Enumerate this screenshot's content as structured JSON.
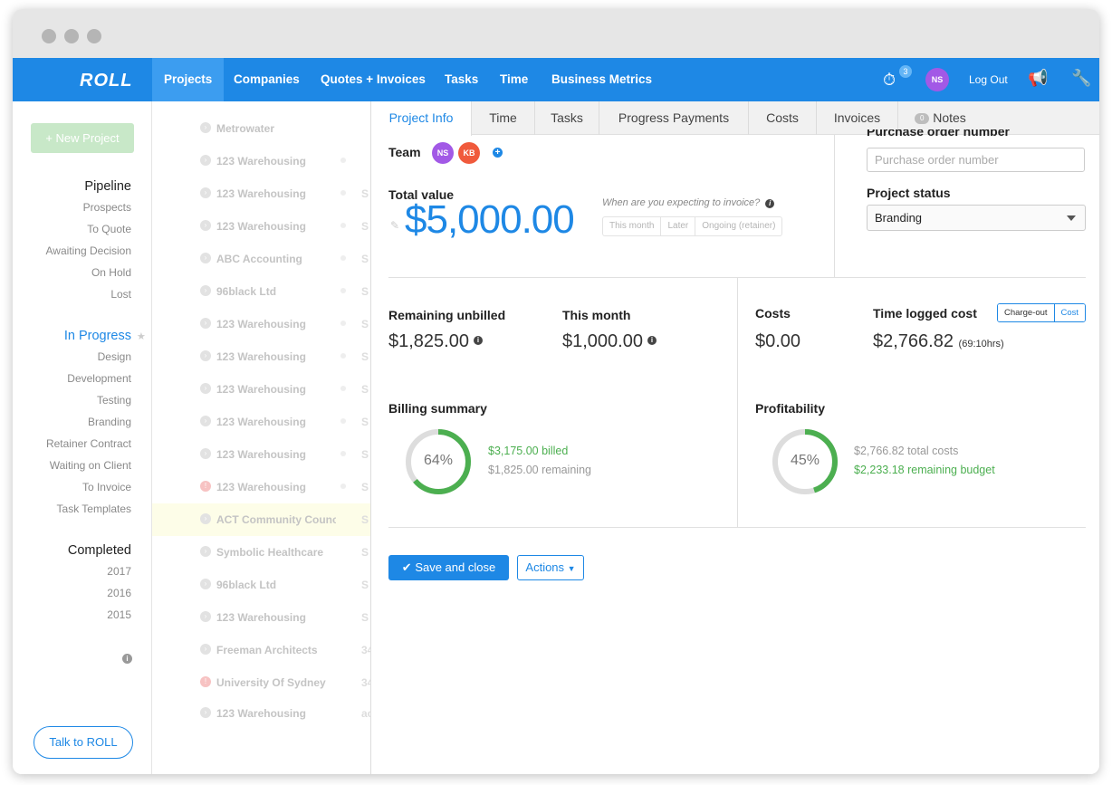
{
  "app": {
    "logo": "ROLL"
  },
  "nav": {
    "items": [
      "Projects",
      "Companies",
      "Quotes + Invoices",
      "Tasks",
      "Time",
      "Business Metrics"
    ],
    "timer_badge": "3",
    "user_initials": "NS",
    "logout_label": "Log Out"
  },
  "sidebar": {
    "new_project": "+ New Project",
    "pipeline": {
      "title": "Pipeline",
      "items": [
        "Prospects",
        "To Quote",
        "Awaiting Decision",
        "On Hold",
        "Lost"
      ]
    },
    "in_progress": {
      "title": "In Progress",
      "items": [
        "Design",
        "Development",
        "Testing",
        "Branding",
        "Retainer Contract",
        "Waiting on Client",
        "To Invoice",
        "Task Templates"
      ]
    },
    "completed": {
      "title": "Completed",
      "items": [
        "2017",
        "2016",
        "2015"
      ]
    },
    "talk_label": "Talk to ROLL"
  },
  "projects": [
    {
      "name": "Metrowater",
      "trail": ""
    },
    {
      "name": "123 Warehousing",
      "trail": ""
    },
    {
      "name": "123 Warehousing",
      "trail": "S"
    },
    {
      "name": "123 Warehousing",
      "trail": "S"
    },
    {
      "name": "ABC Accounting",
      "trail": "S"
    },
    {
      "name": "96black Ltd",
      "trail": "S"
    },
    {
      "name": "123 Warehousing",
      "trail": "S"
    },
    {
      "name": "123 Warehousing",
      "trail": "S"
    },
    {
      "name": "123 Warehousing",
      "trail": "S"
    },
    {
      "name": "123 Warehousing",
      "trail": "S"
    },
    {
      "name": "123 Warehousing",
      "trail": "S"
    },
    {
      "name": "123 Warehousing",
      "trail": "S"
    },
    {
      "name": "ACT Community Counc",
      "trail": "S"
    },
    {
      "name": "Symbolic Healthcare",
      "trail": "S"
    },
    {
      "name": "96black Ltd",
      "trail": "S"
    },
    {
      "name": "123 Warehousing",
      "trail": "S"
    },
    {
      "name": "Freeman Architects",
      "trail": "34"
    },
    {
      "name": "University Of Sydney",
      "trail": "34"
    },
    {
      "name": "123 Warehousing",
      "trail": "ac"
    }
  ],
  "tabs": [
    "Project Info",
    "Time",
    "Tasks",
    "Progress Payments",
    "Costs",
    "Invoices",
    "Notes"
  ],
  "notes_count": "0",
  "project": {
    "team_label": "Team",
    "team": [
      "NS",
      "KB"
    ],
    "total_value_label": "Total value",
    "total_value": "$5,000.00",
    "invoice_question": "When are you expecting to invoice?",
    "invoice_options": [
      "This month",
      "Later",
      "Ongoing (retainer)"
    ],
    "po_label": "Purchase order number",
    "po_placeholder": "Purchase order number",
    "status_label": "Project status",
    "status_value": "Branding"
  },
  "stats": {
    "remaining_unbilled_label": "Remaining unbilled",
    "remaining_unbilled": "$1,825.00",
    "this_month_label": "This month",
    "this_month": "$1,000.00",
    "costs_label": "Costs",
    "costs": "$0.00",
    "time_logged_label": "Time logged cost",
    "time_logged": "$2,766.82",
    "time_logged_hours": "(69:10hrs)",
    "toggle": [
      "Charge-out",
      "Cost"
    ]
  },
  "billing": {
    "title": "Billing summary",
    "percent": 64,
    "percent_label": "64%",
    "billed": "$3,175.00 billed",
    "remaining": "$1,825.00 remaining"
  },
  "profitability": {
    "title": "Profitability",
    "percent": 45,
    "percent_label": "45%",
    "total_costs": "$2,766.82 total costs",
    "remaining_budget": "$2,233.18 remaining budget"
  },
  "buttons": {
    "save": "Save and close",
    "actions": "Actions"
  },
  "colors": {
    "brand": "#1e88e5",
    "green": "#4caf50",
    "ring_bg": "#dddddd",
    "avatar_ns": "#a259e6",
    "avatar_kb": "#f05a3c"
  }
}
